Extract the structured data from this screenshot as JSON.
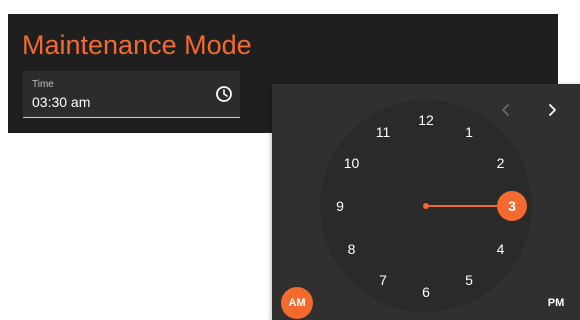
{
  "header": {
    "title": "Maintenance Mode"
  },
  "time_field": {
    "label": "Time",
    "value": "03:30 am",
    "icon": "clock-icon"
  },
  "picker": {
    "hours": [
      "12",
      "1",
      "2",
      "3",
      "4",
      "5",
      "6",
      "7",
      "8",
      "9",
      "10",
      "11"
    ],
    "selected_hour": "3",
    "am_label": "AM",
    "pm_label": "PM",
    "active_period": "AM",
    "prev_icon": "chevron-left-icon",
    "next_icon": "chevron-right-icon"
  },
  "colors": {
    "accent": "#f26a2e",
    "panel": "#1f1f1f",
    "picker_bg": "#303030",
    "dial_bg": "#2a2a2a",
    "text": "#ffffff",
    "nav_disabled": "#6b6b6b"
  }
}
